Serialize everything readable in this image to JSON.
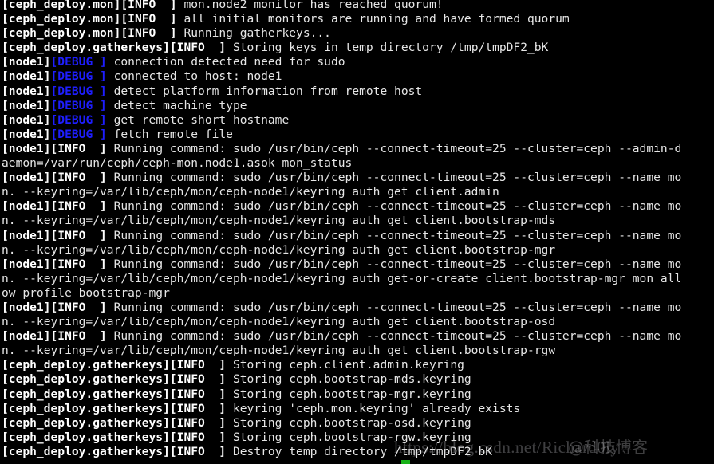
{
  "terminal": {
    "background_color": "#000000",
    "foreground_color": "#e6e6e6",
    "debug_color": "#1e1eff",
    "info_color": "#ffffff",
    "cursor_color": "#18b218",
    "cursor_visible": true,
    "font_size_px": 14.6,
    "line_height_px": 18.1,
    "columns": 98,
    "rows": 32
  },
  "watermark": {
    "url_text": "https://blog.csdn.net/Richard0ly",
    "overlay_text": "@科技博客",
    "color": "rgba(210,210,215,0.30)"
  },
  "log": {
    "lines": [
      {
        "type": "entry",
        "source": "[ceph_deploy.mon]",
        "level": "[INFO  ]",
        "level_kind": "info",
        "message": " mon.node2 monitor has reached quorum!"
      },
      {
        "type": "entry",
        "source": "[ceph_deploy.mon]",
        "level": "[INFO  ]",
        "level_kind": "info",
        "message": " all initial monitors are running and have formed quorum"
      },
      {
        "type": "entry",
        "source": "[ceph_deploy.mon]",
        "level": "[INFO  ]",
        "level_kind": "info",
        "message": " Running gatherkeys..."
      },
      {
        "type": "entry",
        "source": "[ceph_deploy.gatherkeys]",
        "level": "[INFO  ]",
        "level_kind": "info",
        "message": " Storing keys in temp directory /tmp/tmpDF2_bK"
      },
      {
        "type": "entry",
        "source": "[node1]",
        "level": "[DEBUG ]",
        "level_kind": "debug",
        "message": " connection detected need for sudo"
      },
      {
        "type": "entry",
        "source": "[node1]",
        "level": "[DEBUG ]",
        "level_kind": "debug",
        "message": " connected to host: node1"
      },
      {
        "type": "entry",
        "source": "[node1]",
        "level": "[DEBUG ]",
        "level_kind": "debug",
        "message": " detect platform information from remote host"
      },
      {
        "type": "entry",
        "source": "[node1]",
        "level": "[DEBUG ]",
        "level_kind": "debug",
        "message": " detect machine type"
      },
      {
        "type": "entry",
        "source": "[node1]",
        "level": "[DEBUG ]",
        "level_kind": "debug",
        "message": " get remote short hostname"
      },
      {
        "type": "entry",
        "source": "[node1]",
        "level": "[DEBUG ]",
        "level_kind": "debug",
        "message": " fetch remote file"
      },
      {
        "type": "entry",
        "source": "[node1]",
        "level": "[INFO  ]",
        "level_kind": "info",
        "message": " Running command: sudo /usr/bin/ceph --connect-timeout=25 --cluster=ceph --admin-d"
      },
      {
        "type": "continuation",
        "text": "aemon=/var/run/ceph/ceph-mon.node1.asok mon_status"
      },
      {
        "type": "entry",
        "source": "[node1]",
        "level": "[INFO  ]",
        "level_kind": "info",
        "message": " Running command: sudo /usr/bin/ceph --connect-timeout=25 --cluster=ceph --name mo"
      },
      {
        "type": "continuation",
        "text": "n. --keyring=/var/lib/ceph/mon/ceph-node1/keyring auth get client.admin"
      },
      {
        "type": "entry",
        "source": "[node1]",
        "level": "[INFO  ]",
        "level_kind": "info",
        "message": " Running command: sudo /usr/bin/ceph --connect-timeout=25 --cluster=ceph --name mo"
      },
      {
        "type": "continuation",
        "text": "n. --keyring=/var/lib/ceph/mon/ceph-node1/keyring auth get client.bootstrap-mds"
      },
      {
        "type": "entry",
        "source": "[node1]",
        "level": "[INFO  ]",
        "level_kind": "info",
        "message": " Running command: sudo /usr/bin/ceph --connect-timeout=25 --cluster=ceph --name mo"
      },
      {
        "type": "continuation",
        "text": "n. --keyring=/var/lib/ceph/mon/ceph-node1/keyring auth get client.bootstrap-mgr"
      },
      {
        "type": "entry",
        "source": "[node1]",
        "level": "[INFO  ]",
        "level_kind": "info",
        "message": " Running command: sudo /usr/bin/ceph --connect-timeout=25 --cluster=ceph --name mo"
      },
      {
        "type": "continuation",
        "text": "n. --keyring=/var/lib/ceph/mon/ceph-node1/keyring auth get-or-create client.bootstrap-mgr mon all"
      },
      {
        "type": "continuation",
        "text": "ow profile bootstrap-mgr"
      },
      {
        "type": "entry",
        "source": "[node1]",
        "level": "[INFO  ]",
        "level_kind": "info",
        "message": " Running command: sudo /usr/bin/ceph --connect-timeout=25 --cluster=ceph --name mo"
      },
      {
        "type": "continuation",
        "text": "n. --keyring=/var/lib/ceph/mon/ceph-node1/keyring auth get client.bootstrap-osd"
      },
      {
        "type": "entry",
        "source": "[node1]",
        "level": "[INFO  ]",
        "level_kind": "info",
        "message": " Running command: sudo /usr/bin/ceph --connect-timeout=25 --cluster=ceph --name mo"
      },
      {
        "type": "continuation",
        "text": "n. --keyring=/var/lib/ceph/mon/ceph-node1/keyring auth get client.bootstrap-rgw"
      },
      {
        "type": "entry",
        "source": "[ceph_deploy.gatherkeys]",
        "level": "[INFO  ]",
        "level_kind": "info",
        "message": " Storing ceph.client.admin.keyring"
      },
      {
        "type": "entry",
        "source": "[ceph_deploy.gatherkeys]",
        "level": "[INFO  ]",
        "level_kind": "info",
        "message": " Storing ceph.bootstrap-mds.keyring"
      },
      {
        "type": "entry",
        "source": "[ceph_deploy.gatherkeys]",
        "level": "[INFO  ]",
        "level_kind": "info",
        "message": " Storing ceph.bootstrap-mgr.keyring"
      },
      {
        "type": "entry",
        "source": "[ceph_deploy.gatherkeys]",
        "level": "[INFO  ]",
        "level_kind": "info",
        "message": " keyring 'ceph.mon.keyring' already exists"
      },
      {
        "type": "entry",
        "source": "[ceph_deploy.gatherkeys]",
        "level": "[INFO  ]",
        "level_kind": "info",
        "message": " Storing ceph.bootstrap-osd.keyring"
      },
      {
        "type": "entry",
        "source": "[ceph_deploy.gatherkeys]",
        "level": "[INFO  ]",
        "level_kind": "info",
        "message": " Storing ceph.bootstrap-rgw.keyring"
      },
      {
        "type": "entry",
        "source": "[ceph_deploy.gatherkeys]",
        "level": "[INFO  ]",
        "level_kind": "info",
        "message": " Destroy temp directory /tmp/tmpDF2_bK"
      }
    ]
  }
}
